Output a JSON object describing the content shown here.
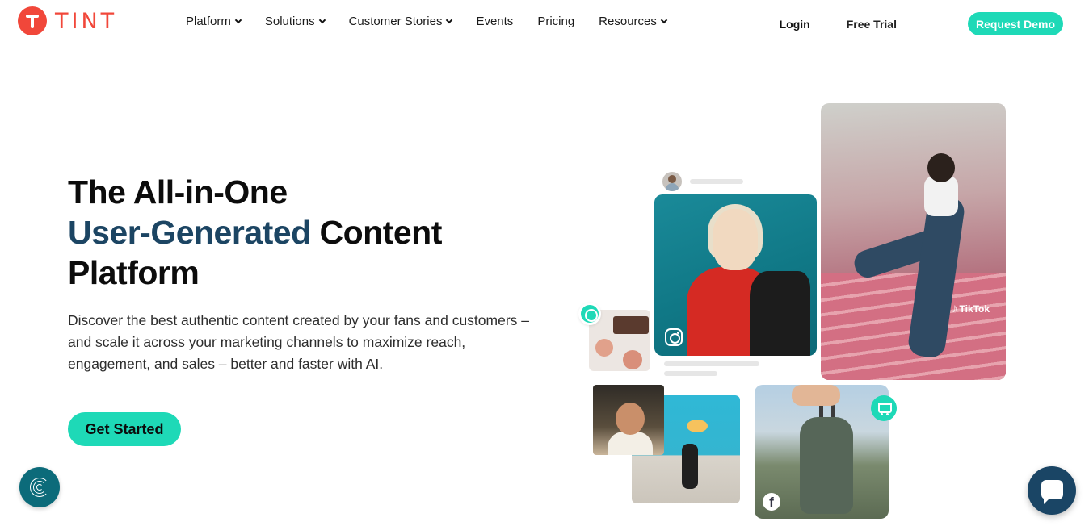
{
  "brand": {
    "name": "TINT",
    "color": "#f1473a"
  },
  "nav": {
    "items": [
      {
        "label": "Platform",
        "dropdown": true
      },
      {
        "label": "Solutions",
        "dropdown": true
      },
      {
        "label": "Customer Stories",
        "dropdown": true
      },
      {
        "label": "Events",
        "dropdown": false
      },
      {
        "label": "Pricing",
        "dropdown": false
      },
      {
        "label": "Resources",
        "dropdown": true
      }
    ],
    "login_label": "Login",
    "trial_label": "Free Trial",
    "demo_label": "Request Demo"
  },
  "hero": {
    "title_line1": "The All-in-One",
    "title_accent": "User-Generated",
    "title_line2_rest": " Content",
    "title_line3": "Platform",
    "description": "Discover the best authentic content created by your fans and customers – and scale it across your marketing channels to maximize reach, engagement, and sales – better and faster with AI.",
    "cta_label": "Get Started"
  },
  "collage": {
    "tiktok_label": "TikTok",
    "facebook_label": "f"
  },
  "colors": {
    "accent_teal": "#1ed9b7",
    "heading_accent": "#1c4563",
    "chat_bg": "#1a4565",
    "fingerprint_bg": "#0c6b7a"
  },
  "icons": {
    "menu_chevron": "chevron-down-icon",
    "instagram": "instagram-icon",
    "tiktok": "tiktok-icon",
    "facebook": "facebook-icon",
    "cart": "shopping-cart-icon",
    "chat": "chat-icon",
    "fingerprint": "fingerprint-icon"
  }
}
